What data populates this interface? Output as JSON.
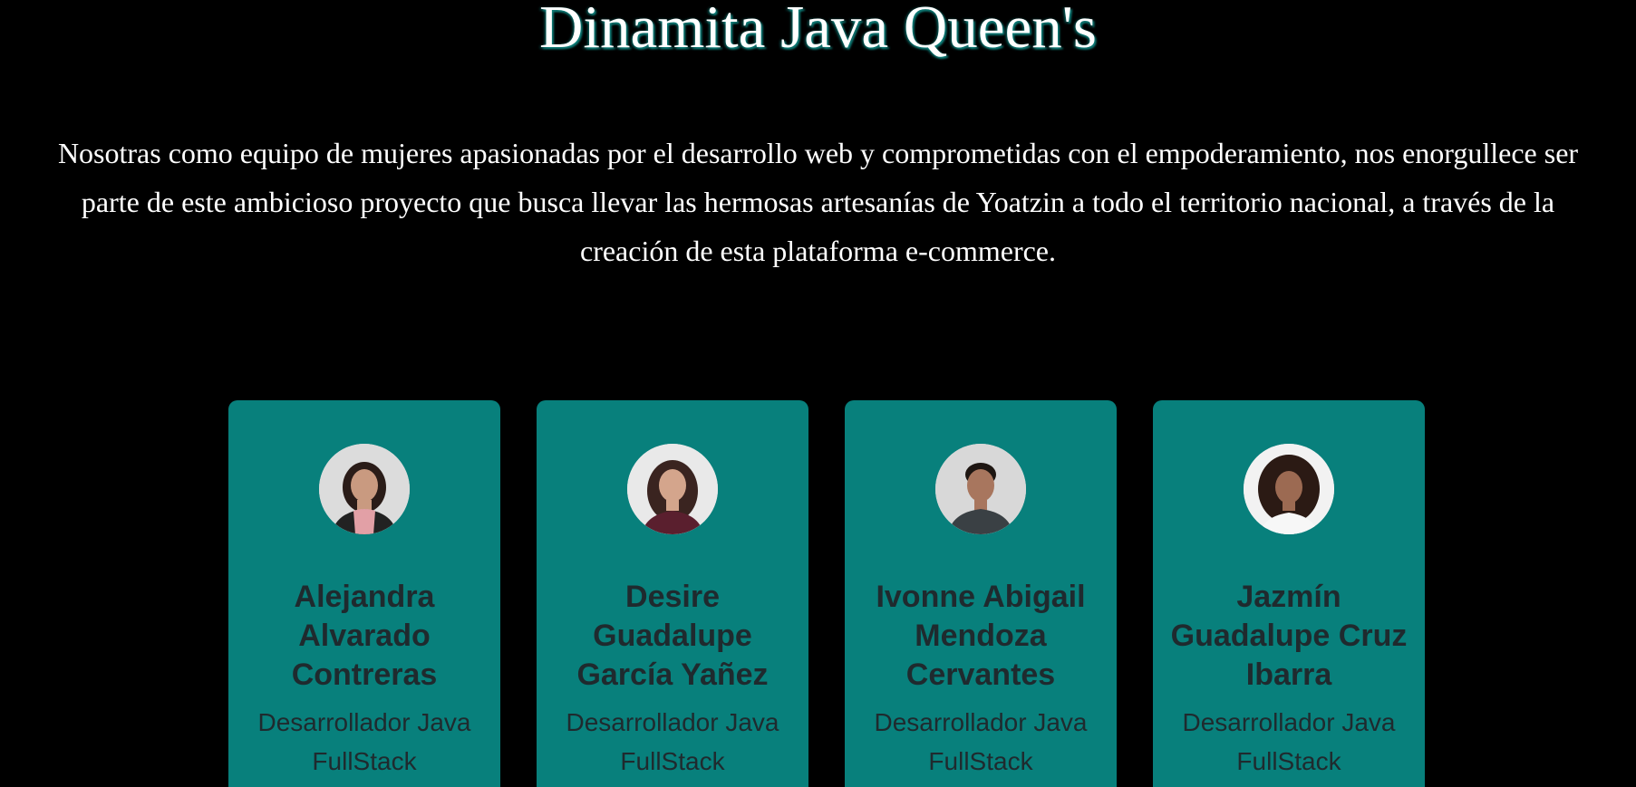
{
  "page": {
    "title": "Dinamita Java Queen's",
    "intro": "Nosotras como equipo de mujeres apasionadas por el desarrollo web y comprometidas con el empoderamiento, nos enorgullece ser parte de este ambicioso proyecto que busca llevar las hermosas artesanías de Yoatzin a todo el territorio nacional, a través de la creación de esta plataforma e-commerce."
  },
  "colors": {
    "background": "#000000",
    "card": "#08807c",
    "card_text": "#1f2a2e",
    "title_glow": "#0e7f7a"
  },
  "team": [
    {
      "name": "Alejandra Alvarado Contreras",
      "role": "Desarrollador Java FullStack",
      "avatar_icon": "profile-photo"
    },
    {
      "name": "Desire Guadalupe García Yañez",
      "role": "Desarrollador Java FullStack",
      "avatar_icon": "profile-photo"
    },
    {
      "name": "Ivonne Abigail Mendoza Cervantes",
      "role": "Desarrollador Java FullStack",
      "avatar_icon": "profile-photo"
    },
    {
      "name": "Jazmín Guadalupe Cruz Ibarra",
      "role": "Desarrollador Java FullStack",
      "avatar_icon": "profile-photo"
    }
  ]
}
